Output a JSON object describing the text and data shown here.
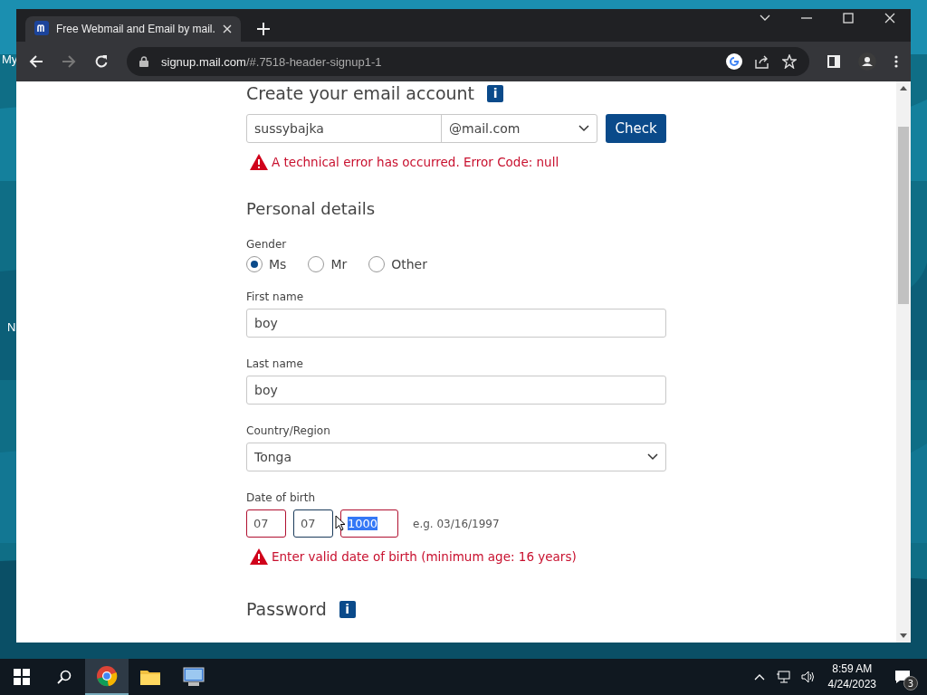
{
  "desktop": {
    "icon_labels": [
      "My",
      "N"
    ]
  },
  "browser": {
    "tab": {
      "title": "Free Webmail and Email by mail.",
      "selected": true
    },
    "url": {
      "host": "signup.mail.com",
      "path": "/#.7518-header-signup1-1"
    }
  },
  "form": {
    "title": "Create your email account",
    "info_glyph": "i",
    "email": {
      "local_part": "sussybajka",
      "domain": "@mail.com",
      "button": "Check",
      "error": "A technical error has occurred. Error Code: null"
    },
    "personal": {
      "title": "Personal details",
      "gender_label": "Gender",
      "genders": [
        {
          "label": "Ms",
          "selected": true
        },
        {
          "label": "Mr",
          "selected": false
        },
        {
          "label": "Other",
          "selected": false
        }
      ],
      "first_name": {
        "label": "First name",
        "value": "boy"
      },
      "last_name": {
        "label": "Last name",
        "value": "boy"
      },
      "country": {
        "label": "Country/Region",
        "value": "Tonga"
      },
      "birth": {
        "label": "Date of birth",
        "fields": [
          {
            "value": "07",
            "invalid": true,
            "focused": false
          },
          {
            "value": "07",
            "invalid": false,
            "focused": false
          },
          {
            "value": "1000",
            "invalid": true,
            "focused": true
          }
        ],
        "hint": "e.g. 03/16/1997",
        "error": "Enter valid date of birth (minimum age: 16 years)"
      }
    },
    "password": {
      "title": "Password",
      "info_glyph": "i"
    }
  },
  "taskbar": {
    "time": "8:59 AM",
    "date": "4/24/2023",
    "notifications": "3"
  }
}
